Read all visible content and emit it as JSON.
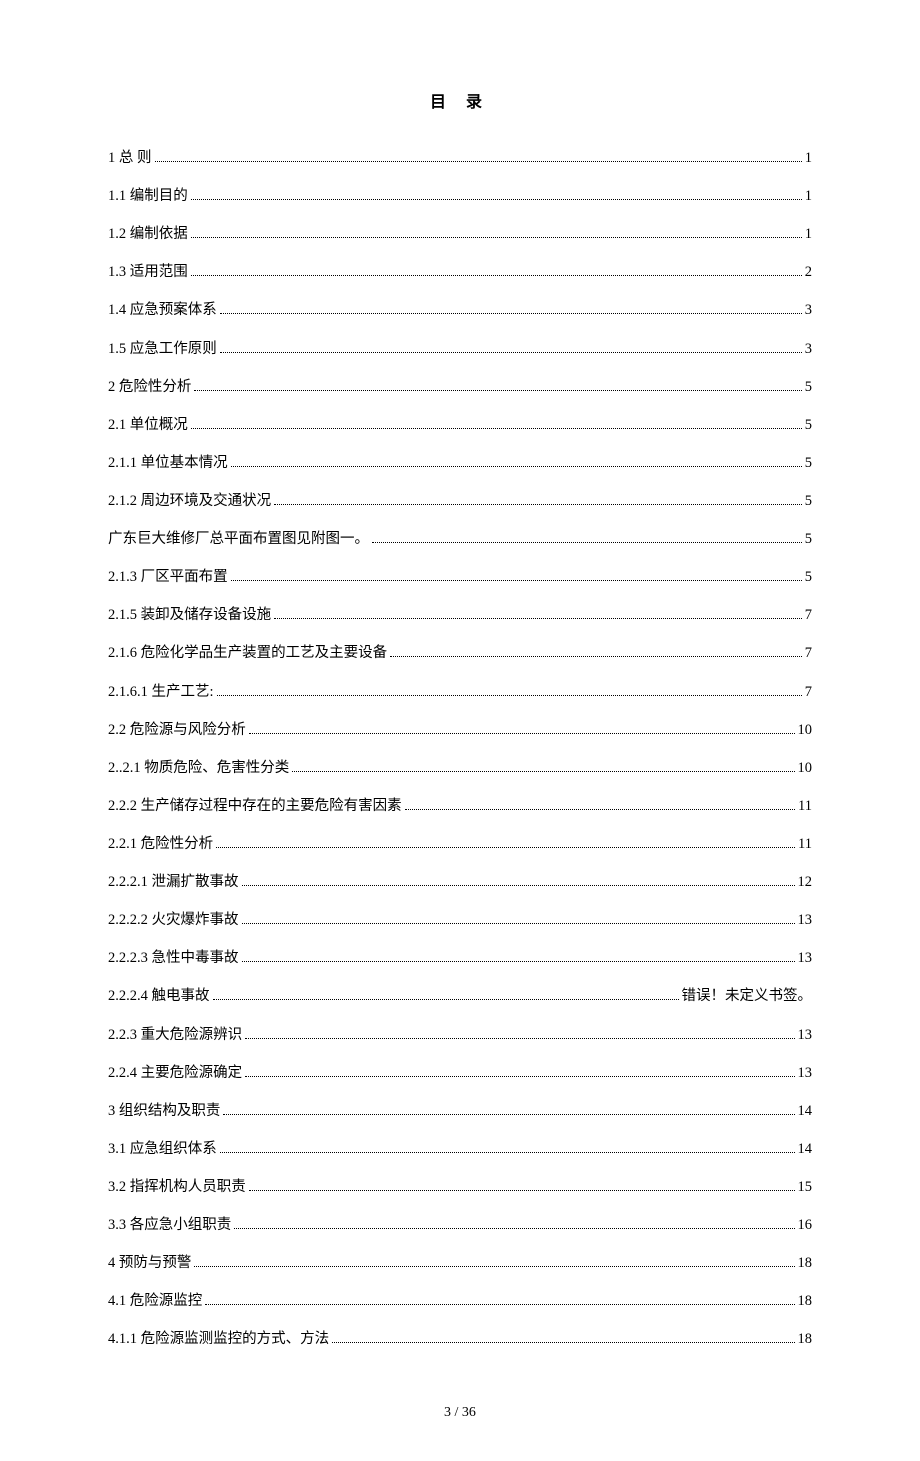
{
  "title": "目  录",
  "footer": "3 / 36",
  "error_prefix": "错误！",
  "error_rest": "未定义书签。",
  "toc": [
    {
      "label": "1 总    则",
      "page": "1"
    },
    {
      "label": "1.1 编制目的",
      "page": "1"
    },
    {
      "label": "1.2 编制依据",
      "page": "1"
    },
    {
      "label": "1.3 适用范围",
      "page": "2"
    },
    {
      "label": "1.4 应急预案体系",
      "page": "3"
    },
    {
      "label": "1.5 应急工作原则",
      "page": "3"
    },
    {
      "label": "2 危险性分析",
      "page": "5"
    },
    {
      "label": "2.1 单位概况",
      "page": "5"
    },
    {
      "label": "2.1.1 单位基本情况",
      "page": "5"
    },
    {
      "label": "2.1.2 周边环境及交通状况",
      "page": "5"
    },
    {
      "label": "广东巨大维修厂总平面布置图见附图一。",
      "page": "5"
    },
    {
      "label": "2.1.3 厂区平面布置",
      "page": "5"
    },
    {
      "label": "2.1.5 装卸及储存设备设施",
      "page": "7"
    },
    {
      "label": "2.1.6 危险化学品生产装置的工艺及主要设备",
      "page": "7"
    },
    {
      "label": "2.1.6.1 生产工艺:",
      "page": "7"
    },
    {
      "label": "2.2 危险源与风险分析",
      "page": "10"
    },
    {
      "label": "2..2.1 物质危险、危害性分类",
      "page": "10"
    },
    {
      "label": "2.2.2 生产储存过程中存在的主要危险有害因素",
      "page": "11"
    },
    {
      "label": "2.2.1 危险性分析",
      "page": "11"
    },
    {
      "label": "2.2.2.1 泄漏扩散事故",
      "page": "12"
    },
    {
      "label": "2.2.2.2 火灾爆炸事故",
      "page": "13"
    },
    {
      "label": "2.2.2.3 急性中毒事故",
      "page": "13"
    },
    {
      "label": "2.2.2.4 触电事故",
      "page": "ERROR"
    },
    {
      "label": "2.2.3 重大危险源辨识",
      "page": "13"
    },
    {
      "label": "2.2.4 主要危险源确定",
      "page": "13"
    },
    {
      "label": "3 组织结构及职责",
      "page": "14"
    },
    {
      "label": "3.1 应急组织体系",
      "page": "14"
    },
    {
      "label": "3.2 指挥机构人员职责",
      "page": "15"
    },
    {
      "label": "3.3 各应急小组职责",
      "page": "16"
    },
    {
      "label": "4 预防与预警",
      "page": "18"
    },
    {
      "label": "4.1 危险源监控",
      "page": "18"
    },
    {
      "label": "4.1.1 危险源监测监控的方式、方法",
      "page": "18"
    }
  ]
}
